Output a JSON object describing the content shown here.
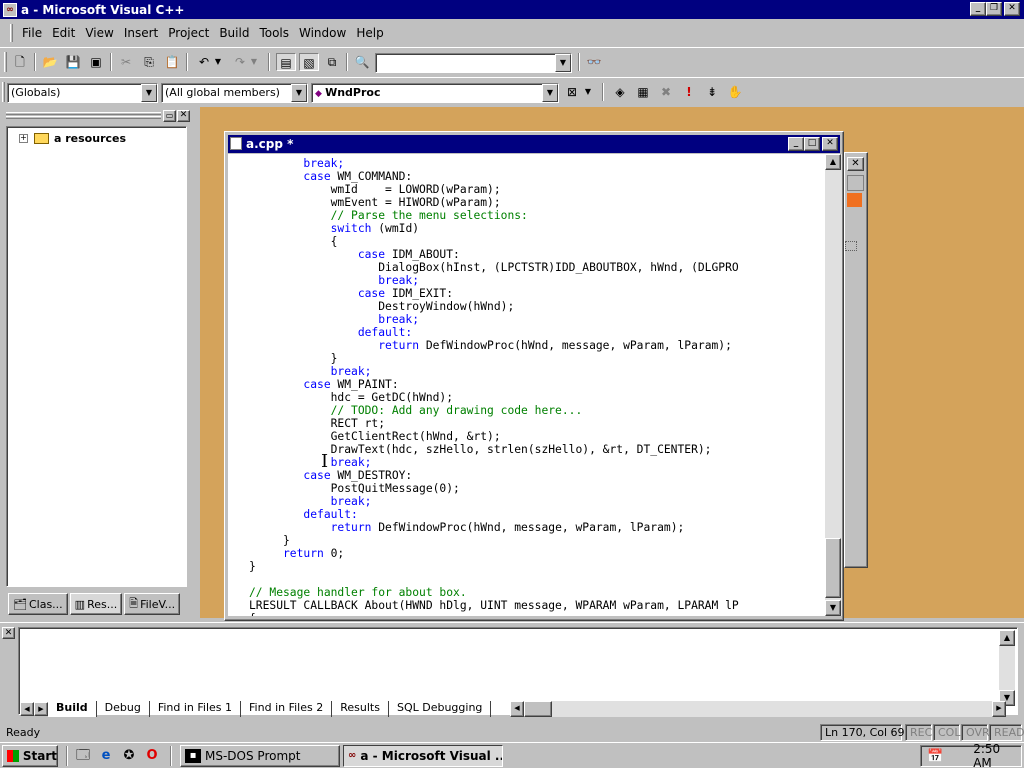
{
  "window": {
    "title": "a - Microsoft Visual C++"
  },
  "menu": [
    "File",
    "Edit",
    "View",
    "Insert",
    "Project",
    "Build",
    "Tools",
    "Window",
    "Help"
  ],
  "toolbar": {
    "find_combo_value": "",
    "scope_combo": "(Globals)",
    "members_combo": "(All global members)",
    "function_combo": "WndProc"
  },
  "workspace": {
    "tree_item": "a resources",
    "tabs": [
      "Clas...",
      "Res...",
      "FileV..."
    ]
  },
  "editor": {
    "title": "a.cpp *",
    "code_lines": [
      [
        [
          "kw",
          "        break;"
        ]
      ],
      [
        [
          "kw",
          "        case "
        ],
        [
          "t",
          "WM_COMMAND:"
        ]
      ],
      [
        [
          "t",
          "            wmId    = LOWORD(wParam);"
        ]
      ],
      [
        [
          "t",
          "            wmEvent = HIWORD(wParam);"
        ]
      ],
      [
        [
          "cm",
          "            // Parse the menu selections:"
        ]
      ],
      [
        [
          "kw",
          "            switch "
        ],
        [
          "t",
          "(wmId)"
        ]
      ],
      [
        [
          "t",
          "            {"
        ]
      ],
      [
        [
          "kw",
          "                case "
        ],
        [
          "t",
          "IDM_ABOUT:"
        ]
      ],
      [
        [
          "t",
          "                   DialogBox(hInst, (LPCTSTR)IDD_ABOUTBOX, hWnd, (DLGPRO"
        ]
      ],
      [
        [
          "kw",
          "                   break;"
        ]
      ],
      [
        [
          "kw",
          "                case "
        ],
        [
          "t",
          "IDM_EXIT:"
        ]
      ],
      [
        [
          "t",
          "                   DestroyWindow(hWnd);"
        ]
      ],
      [
        [
          "kw",
          "                   break;"
        ]
      ],
      [
        [
          "kw",
          "                default:"
        ]
      ],
      [
        [
          "kw",
          "                   return "
        ],
        [
          "t",
          "DefWindowProc(hWnd, message, wParam, lParam);"
        ]
      ],
      [
        [
          "t",
          "            }"
        ]
      ],
      [
        [
          "kw",
          "            break;"
        ]
      ],
      [
        [
          "kw",
          "        case "
        ],
        [
          "t",
          "WM_PAINT:"
        ]
      ],
      [
        [
          "t",
          "            hdc = GetDC(hWnd);"
        ]
      ],
      [
        [
          "cm",
          "            // TODO: Add any drawing code here..."
        ]
      ],
      [
        [
          "t",
          "            RECT rt;"
        ]
      ],
      [
        [
          "t",
          "            GetClientRect(hWnd, &rt);"
        ]
      ],
      [
        [
          "t",
          "            DrawText(hdc, szHello, strlen(szHello), &rt, DT_CENTER);"
        ]
      ],
      [
        [
          "kw",
          "            break;"
        ]
      ],
      [
        [
          "kw",
          "        case "
        ],
        [
          "t",
          "WM_DESTROY:"
        ]
      ],
      [
        [
          "t",
          "            PostQuitMessage(0);"
        ]
      ],
      [
        [
          "kw",
          "            break;"
        ]
      ],
      [
        [
          "kw",
          "        default:"
        ]
      ],
      [
        [
          "kw",
          "            return "
        ],
        [
          "t",
          "DefWindowProc(hWnd, message, wParam, lParam);"
        ]
      ],
      [
        [
          "t",
          "     }"
        ]
      ],
      [
        [
          "kw",
          "     return "
        ],
        [
          "t",
          "0;"
        ]
      ],
      [
        [
          "t",
          "}"
        ]
      ],
      [
        [
          "t",
          ""
        ]
      ],
      [
        [
          "cm",
          "// Mesage handler for about box."
        ]
      ],
      [
        [
          "t",
          "LRESULT CALLBACK About(HWND hDlg, UINT message, WPARAM wParam, LPARAM lP"
        ]
      ],
      [
        [
          "t",
          "{"
        ]
      ]
    ]
  },
  "output": {
    "tabs": [
      "Build",
      "Debug",
      "Find in Files 1",
      "Find in Files 2",
      "Results",
      "SQL Debugging"
    ]
  },
  "status": {
    "text": "Ready",
    "position": "Ln 170, Col 69",
    "indicators": [
      "REC",
      "COL",
      "OVR",
      "READ"
    ]
  },
  "taskbar": {
    "start": "Start",
    "tasks": [
      "MS-DOS Prompt",
      "a - Microsoft Visual ..."
    ],
    "clock": "2:50 AM"
  }
}
